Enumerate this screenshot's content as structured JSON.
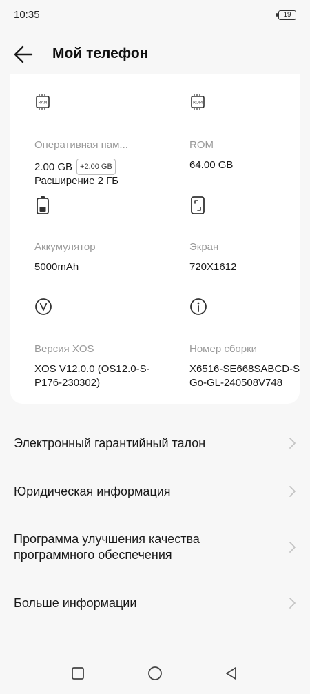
{
  "status_bar": {
    "time": "10:35",
    "battery": "19"
  },
  "header": {
    "title": "Мой телефон",
    "back_icon": "arrow-left-icon"
  },
  "specs": [
    {
      "icon": "ram-chip-icon",
      "icon_text": "RAM",
      "label": "Оперативная пам...",
      "value": "2.00 GB",
      "badge": "+2.00 GB",
      "extra": "Расширение 2 ГБ"
    },
    {
      "icon": "rom-chip-icon",
      "icon_text": "ROM",
      "label": "ROM",
      "value": "64.00 GB"
    },
    {
      "icon": "battery-icon",
      "label": "Аккумулятор",
      "value": "5000mAh"
    },
    {
      "icon": "screen-icon",
      "label": "Экран",
      "value": "720X1612"
    },
    {
      "icon": "xos-version-icon",
      "icon_text": "V",
      "label": "Версия XOS",
      "value": "XOS V12.0.0 (OS12.0-S-P176-230302)"
    },
    {
      "icon": "info-icon",
      "label": "Номер сборки",
      "value": "X6516-SE668SABCD-SGo-GL-240508V748"
    }
  ],
  "menu": [
    {
      "label": "Электронный гарантийный талон"
    },
    {
      "label": "Юридическая информация"
    },
    {
      "label": "Программа улучшения качества программного обеспечения"
    },
    {
      "label": "Больше информации"
    }
  ],
  "nav": {
    "recent": "square-icon",
    "home": "circle-icon",
    "back": "triangle-back-icon"
  },
  "colors": {
    "background": "#f7f7f7",
    "card": "#ffffff",
    "secondary_text": "#9a9a9a",
    "chevron": "#c4c4c4"
  }
}
